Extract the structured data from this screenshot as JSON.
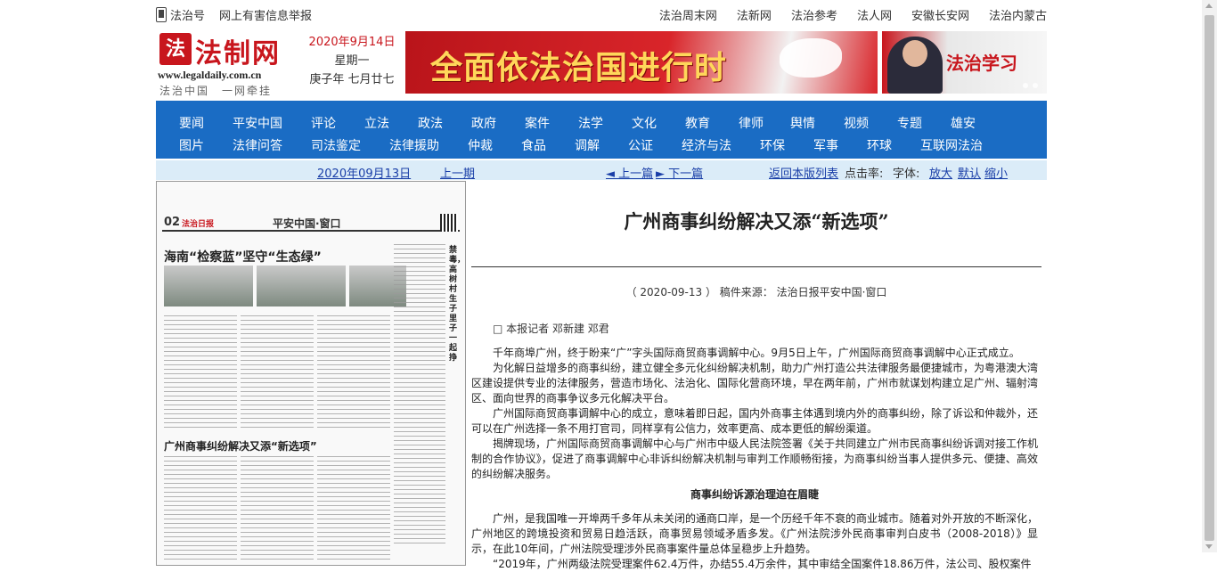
{
  "topbar": {
    "left_links": [
      "法治号",
      "网上有害信息举报"
    ],
    "right_links": [
      "法治周末网",
      "法新网",
      "法治参考",
      "法人网",
      "安徽长安网",
      "法治内蒙古"
    ]
  },
  "logo": {
    "name": "法制网",
    "url": "www.legaldaily.com.cn",
    "slogan": "法治中国　一网牵挂"
  },
  "date": {
    "gregorian": "2020年9月14日",
    "weekday": "星期一",
    "lunar": "庚子年 七月廿七"
  },
  "banners": {
    "main_text": "全面依法治国进行时",
    "side_text": "法治学习"
  },
  "nav": {
    "row1": [
      "要闻",
      "平安中国",
      "评论",
      "立法",
      "政法",
      "政府",
      "案件",
      "法学",
      "文化",
      "教育",
      "律师",
      "舆情",
      "视频",
      "专题",
      "雄安"
    ],
    "row2": [
      "图片",
      "法律问答",
      "司法鉴定",
      "法律援助",
      "仲裁",
      "食品",
      "调解",
      "公证",
      "经济与法",
      "环保",
      "军事",
      "环球",
      "互联网法治"
    ]
  },
  "subbar": {
    "date_link": "2020年09月13日",
    "prev_issue": "上一期",
    "prev_article": "◄ 上一篇",
    "next_article": "► 下一篇",
    "back_link": "返回本版列表",
    "clicks_label": "点击率:",
    "font_label": "字体:",
    "font_large": "放大",
    "font_default": "默认",
    "font_small": "缩小"
  },
  "paper": {
    "page_no": "02",
    "paper_name": "法治日报",
    "section": "平安中国·窗口",
    "headline_1": "海南“检察蓝”坚守“生态绿”",
    "headline_2": "广州商事纠纷解决又添“新选项”",
    "side_title": "禁毒，高树村生子里子一起挣"
  },
  "article": {
    "title": "广州商事纠纷解决又添“新选项”",
    "meta": "（ 2020-09-13 ）  稿件来源：  法治日报平安中国·窗口",
    "byline": "□ 本报记者 邓新建 邓君",
    "paragraphs": [
      "千年商埠广州，终于盼来“广”字头国际商贸商事调解中心。9月5日上午，广州国际商贸商事调解中心正式成立。",
      "为化解日益增多的商事纠纷，建立健全多元化纠纷解决机制，助力广州打造公共法律服务最便捷城市，为粤港澳大湾区建设提供专业的法律服务，营造市场化、法治化、国际化营商环境，早在两年前，广州市就谋划构建立足广州、辐射湾区、面向世界的商事争议多元化解决平台。",
      "广州国际商贸商事调解中心的成立，意味着即日起，国内外商事主体遇到境内外的商事纠纷，除了诉讼和仲裁外，还可以在广州选择一条不用打官司，同样享有公信力，效率更高、成本更低的解纷渠道。",
      "揭牌现场，广州国际商贸商事调解中心与广州市中级人民法院签署《关于共同建立广州市民商事纠纷诉调对接工作机制的合作协议》，促进了商事调解中心非诉纠纷解决机制与审判工作顺畅衔接，为商事纠纷当事人提供多元、便捷、高效的纠纷解决服务。"
    ],
    "subheading": "商事纠纷诉源治理迫在眉睫",
    "paragraphs_2": [
      "广州，是我国唯一开埠两千多年从未关闭的通商口岸，是一个历经千年不衰的商业城市。随着对外开放的不断深化，广州地区的跨境投资和贸易日趋活跃，商事贸易领域矛盾多发。《广州法院涉外民商事审判白皮书（2008-2018）》显示，在此10年间，广州法院受理涉外民商事案件量总体呈稳步上升趋势。",
      "“2019年，广州两级法院受理案件62.4万件，办结55.4万余件，其中审结全国案件18.86万件，法公司、股权案件"
    ]
  }
}
